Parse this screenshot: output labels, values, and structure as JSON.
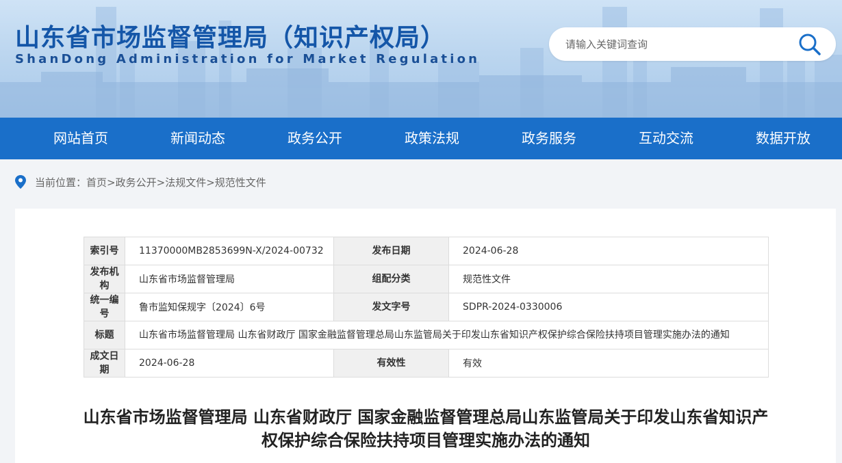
{
  "header": {
    "title": "山东省市场监督管理局（知识产权局）",
    "subtitle": "ShanDong Administration for Market Regulation",
    "search_placeholder": "请输入关键词查询"
  },
  "nav": {
    "items": [
      {
        "label": "网站首页"
      },
      {
        "label": "新闻动态"
      },
      {
        "label": "政务公开"
      },
      {
        "label": "政策法规"
      },
      {
        "label": "政务服务"
      },
      {
        "label": "互动交流"
      },
      {
        "label": "数据开放"
      }
    ]
  },
  "breadcrumb": {
    "prefix": "当前位置：",
    "items": [
      "首页",
      "政务公开",
      "法规文件",
      "规范性文件"
    ],
    "separator": ">"
  },
  "meta": {
    "index_label": "索引号",
    "index_value": "11370000MB2853699N-X/2024-00732",
    "date_label": "发布日期",
    "date_value": "2024-06-28",
    "org_label": "发布机构",
    "org_value": "山东省市场监督管理局",
    "category_label": "组配分类",
    "category_value": "规范性文件",
    "code_label": "统一编号",
    "code_value": "鲁市监知保规字〔2024〕6号",
    "docno_label": "发文字号",
    "docno_value": "SDPR-2024-0330006",
    "title_label": "标题",
    "title_value": "山东省市场监督管理局 山东省财政厅 国家金融监督管理总局山东监管局关于印发山东省知识产权保护综合保险扶持项目管理实施办法的通知",
    "formed_label": "成文日期",
    "formed_value": "2024-06-28",
    "validity_label": "有效性",
    "validity_value": "有效"
  },
  "document": {
    "title": "山东省市场监督管理局 山东省财政厅 国家金融监督管理总局山东监管局关于印发山东省知识产权保护综合保险扶持项目管理实施办法的通知"
  },
  "colors": {
    "nav_bg": "#1a6fc9",
    "title_blue": "#1456a8"
  }
}
